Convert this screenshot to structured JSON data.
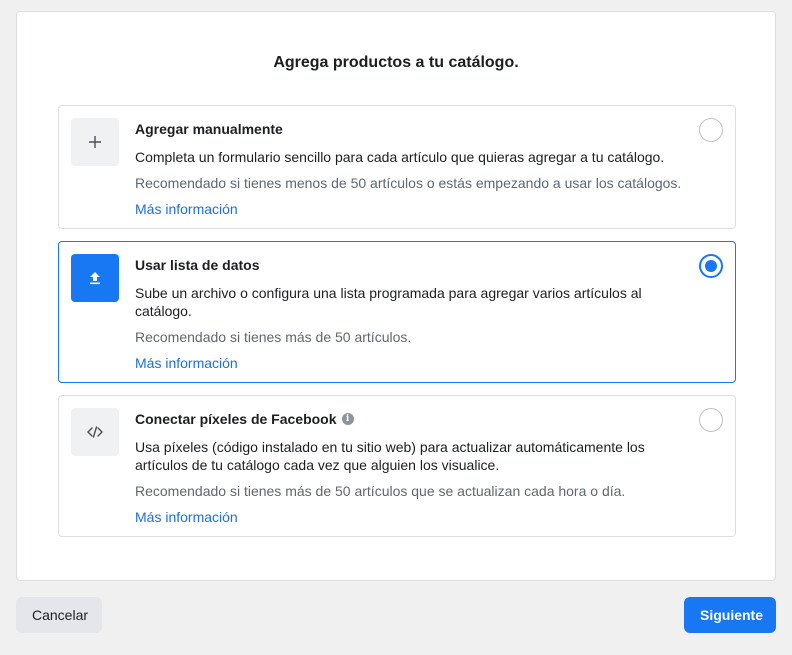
{
  "title": "Agrega productos a tu catálogo.",
  "options": [
    {
      "icon": "plus-icon",
      "title": "Agregar manualmente",
      "description": "Completa un formulario sencillo para cada artículo que quieras agregar a tu catálogo.",
      "recommendation": "Recomendado si tienes menos de 50 artículos o estás empezando a usar los catálogos.",
      "link": "Más información",
      "selected": false
    },
    {
      "icon": "upload-icon",
      "title": "Usar lista de datos",
      "description": "Sube un archivo o configura una lista programada para agregar varios artículos al catálogo.",
      "recommendation": "Recomendado si tienes más de 50 artículos.",
      "link": "Más información",
      "selected": true
    },
    {
      "icon": "code-icon",
      "title": "Conectar píxeles de Facebook",
      "description": "Usa píxeles (código instalado en tu sitio web) para actualizar automáticamente los artículos de tu catálogo cada vez que alguien los visualice.",
      "recommendation": "Recomendado si tienes más de 50 artículos que se actualizan cada hora o día.",
      "link": "Más información",
      "selected": false,
      "info_icon": "info-icon"
    }
  ],
  "buttons": {
    "cancel": "Cancelar",
    "next": "Siguiente"
  },
  "colors": {
    "accent": "#1877f2",
    "link": "#216fdb",
    "background": "#f0f0f0"
  }
}
